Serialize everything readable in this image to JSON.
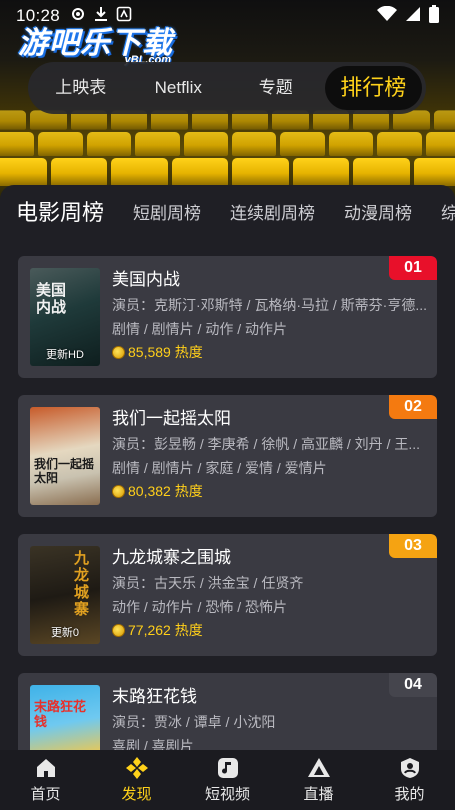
{
  "status_bar": {
    "time": "10:28"
  },
  "logo": {
    "main": "游吧乐下载",
    "sub": "yBL.com"
  },
  "top_tabs": [
    {
      "label": "上映表",
      "active": false
    },
    {
      "label": "Netflix",
      "active": false
    },
    {
      "label": "专题",
      "active": false
    },
    {
      "label": "排行榜",
      "active": true
    }
  ],
  "sub_tabs": [
    {
      "label": "电影周榜",
      "active": true
    },
    {
      "label": "短剧周榜",
      "active": false
    },
    {
      "label": "连续剧周榜",
      "active": false
    },
    {
      "label": "动漫周榜",
      "active": false
    },
    {
      "label": "综艺",
      "active": false
    }
  ],
  "items": [
    {
      "rank": "01",
      "rank_color": "#e8102a",
      "title": "美国内战",
      "cast": "演员：克斯汀·邓斯特 / 瓦格纳·马拉 / 斯蒂芬·亨德...",
      "genres": "剧情 / 剧情片 / 动作 / 动作片",
      "heat": "85,589 热度",
      "poster_text": "美国内战",
      "poster_tag": "更新HD"
    },
    {
      "rank": "02",
      "rank_color": "#f47a10",
      "title": "我们一起摇太阳",
      "cast": "演员：彭昱畅 / 李庚希 / 徐帆 / 高亚麟 / 刘丹 / 王...",
      "genres": "剧情 / 剧情片 / 家庭 / 爱情 / 爱情片",
      "heat": "80,382 热度",
      "poster_text": "我们一起摇太阳",
      "poster_tag": ""
    },
    {
      "rank": "03",
      "rank_color": "#f5a312",
      "title": "九龙城寨之围城",
      "cast": "演员：古天乐 / 洪金宝 / 任贤齐",
      "genres": "动作 / 动作片 / 恐怖 / 恐怖片",
      "heat": "77,262 热度",
      "poster_text": "九龙城寨",
      "poster_tag": "更新0"
    },
    {
      "rank": "04",
      "rank_color": "#45454d",
      "title": "末路狂花钱",
      "cast": "演员：贾冰 / 谭卓 / 小沈阳",
      "genres": "喜剧 / 喜剧片",
      "heat": "",
      "poster_text": "末路狂花钱",
      "poster_tag": ""
    }
  ],
  "bottom_nav": [
    {
      "label": "首页",
      "icon": "home-icon",
      "active": false
    },
    {
      "label": "发现",
      "icon": "discover-icon",
      "active": true
    },
    {
      "label": "短视频",
      "icon": "music-note-icon",
      "active": false
    },
    {
      "label": "直播",
      "icon": "live-icon",
      "active": false
    },
    {
      "label": "我的",
      "icon": "profile-icon",
      "active": false
    }
  ],
  "colors": {
    "accent": "#ffd21a",
    "panel": "#1f1f25",
    "card": "#3a3a42",
    "heat": "#ffcf1a"
  }
}
